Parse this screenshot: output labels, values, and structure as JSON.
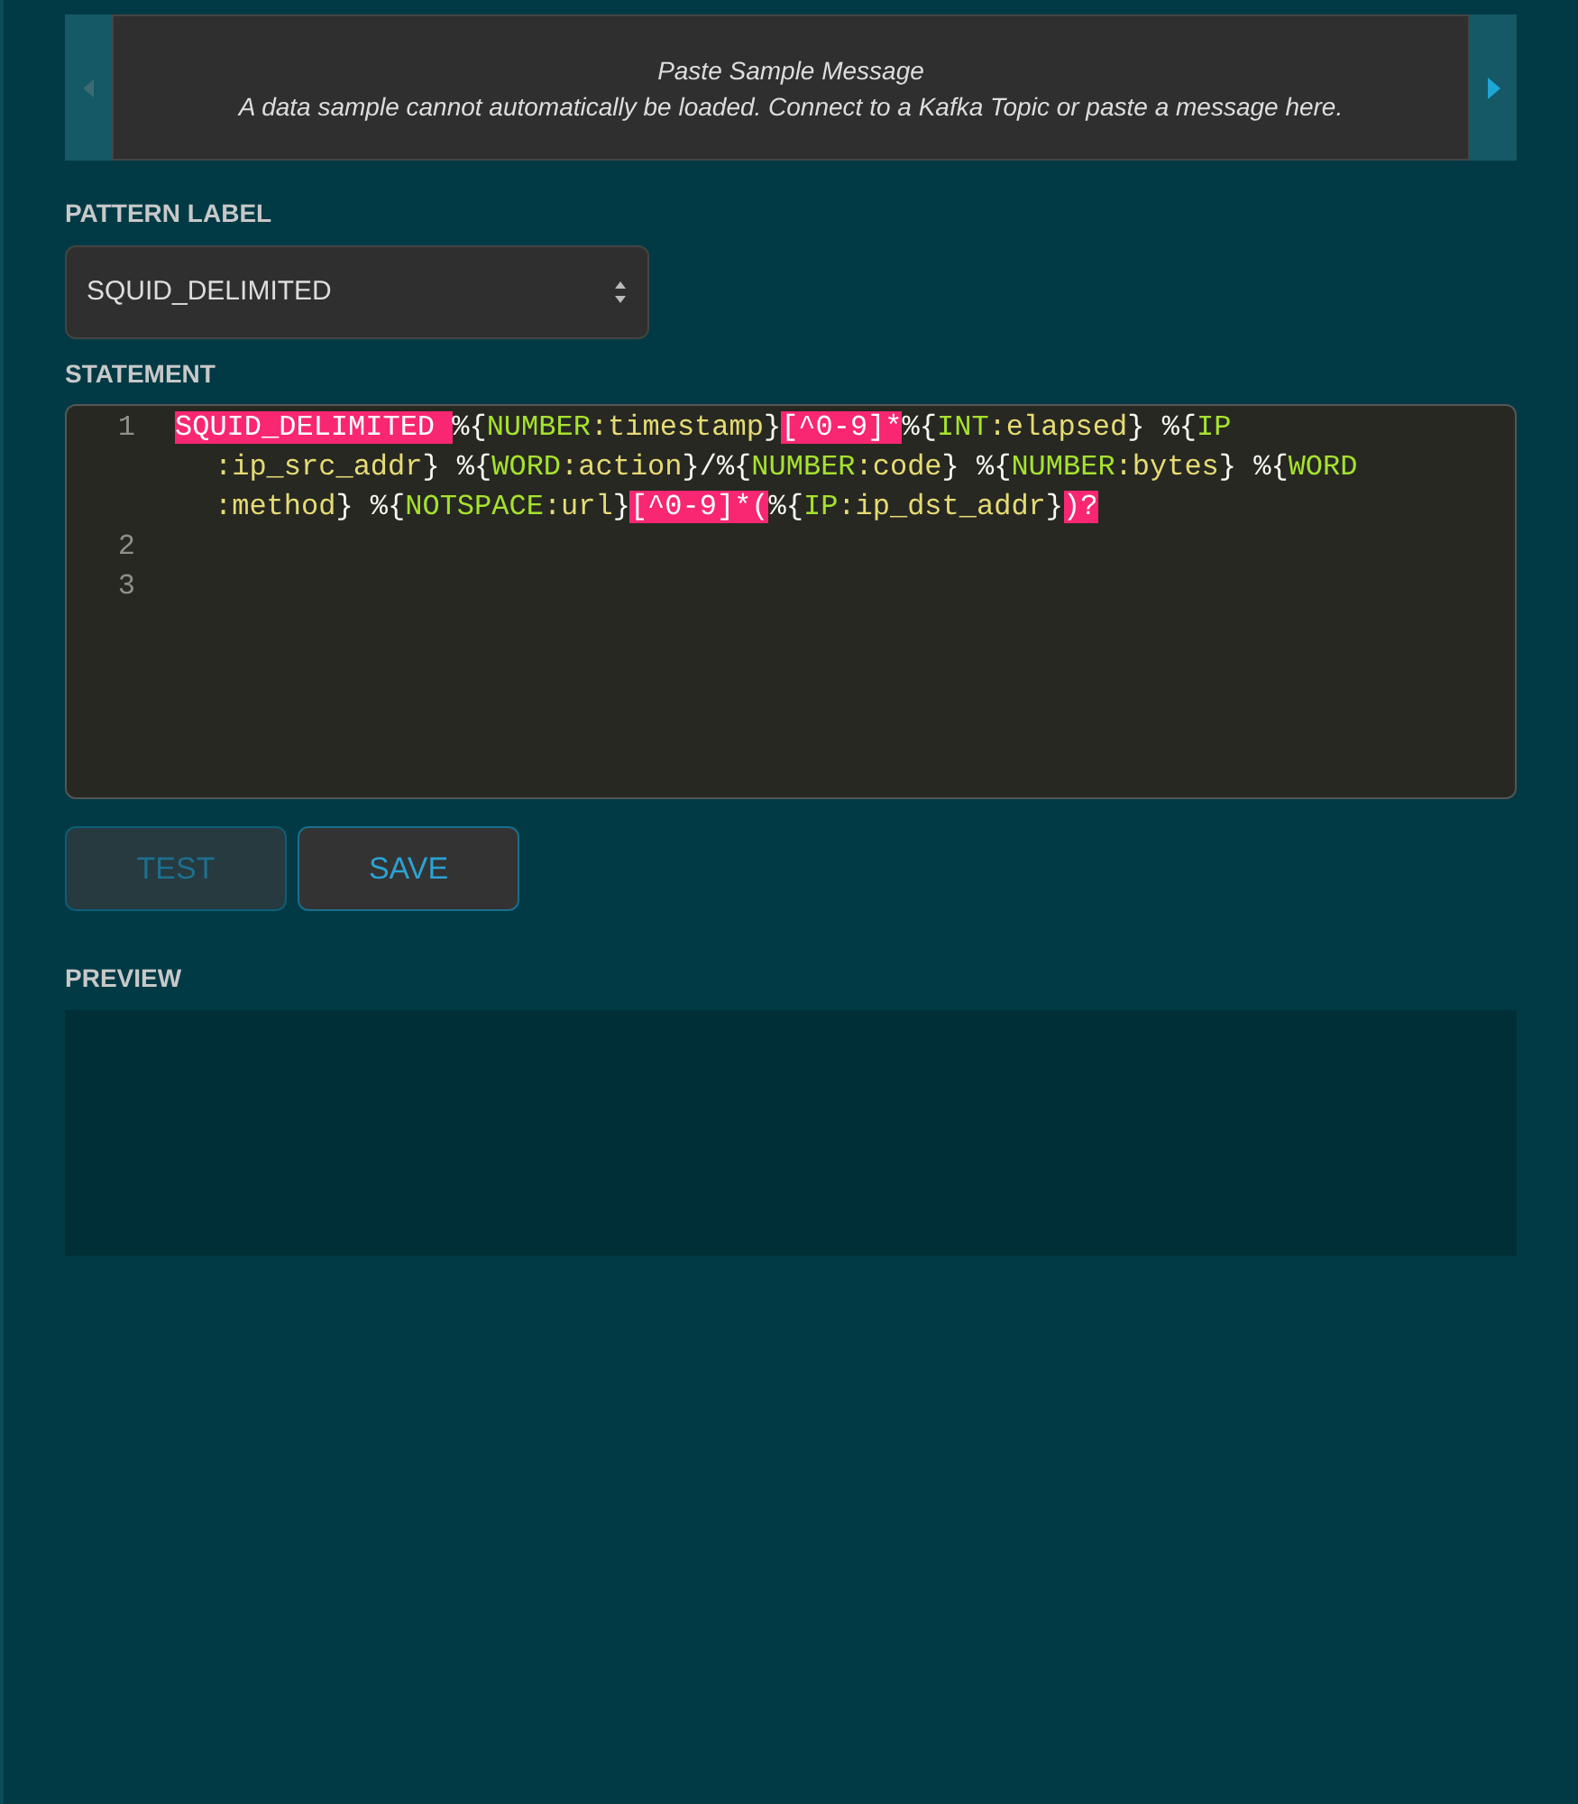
{
  "sample_message": {
    "title": "Paste Sample Message",
    "text": "A data sample cannot automatically be loaded. Connect to a Kafka Topic or paste a message here."
  },
  "pattern_label": {
    "label": "PATTERN LABEL",
    "value": "SQUID_DELIMITED"
  },
  "statement": {
    "label": "STATEMENT",
    "lines": [
      {
        "number": "1",
        "tokens": [
          {
            "kind": "highlight",
            "text": "SQUID_DELIMITED "
          },
          {
            "kind": "punct",
            "text": "%{"
          },
          {
            "kind": "pattern",
            "text": "NUMBER"
          },
          {
            "kind": "field",
            "text": ":timestamp"
          },
          {
            "kind": "punct",
            "text": "}"
          },
          {
            "kind": "highlight",
            "text": "[^0-9]*"
          },
          {
            "kind": "punct",
            "text": "%{"
          },
          {
            "kind": "pattern",
            "text": "INT"
          },
          {
            "kind": "field",
            "text": ":elapsed"
          },
          {
            "kind": "punct",
            "text": "} %{"
          },
          {
            "kind": "pattern",
            "text": "IP"
          },
          {
            "kind": "field",
            "text": ":ip_src_addr"
          },
          {
            "kind": "punct",
            "text": "} %{"
          },
          {
            "kind": "pattern",
            "text": "WORD"
          },
          {
            "kind": "field",
            "text": ":action"
          },
          {
            "kind": "punct",
            "text": "}/%{"
          },
          {
            "kind": "pattern",
            "text": "NUMBER"
          },
          {
            "kind": "field",
            "text": ":code"
          },
          {
            "kind": "punct",
            "text": "} %{"
          },
          {
            "kind": "pattern",
            "text": "NUMBER"
          },
          {
            "kind": "field",
            "text": ":bytes"
          },
          {
            "kind": "punct",
            "text": "} %{"
          },
          {
            "kind": "pattern",
            "text": "WORD"
          },
          {
            "kind": "field",
            "text": ":method"
          },
          {
            "kind": "punct",
            "text": "} %{"
          },
          {
            "kind": "pattern",
            "text": "NOTSPACE"
          },
          {
            "kind": "field",
            "text": ":url"
          },
          {
            "kind": "punct",
            "text": "}"
          },
          {
            "kind": "highlight",
            "text": "[^0-9]*("
          },
          {
            "kind": "punct",
            "text": "%{"
          },
          {
            "kind": "pattern",
            "text": "IP"
          },
          {
            "kind": "field",
            "text": ":ip_dst_addr"
          },
          {
            "kind": "punct",
            "text": "}"
          },
          {
            "kind": "highlight",
            "text": ")?"
          }
        ]
      },
      {
        "number": "2"
      },
      {
        "number": "3"
      }
    ]
  },
  "buttons": [
    {
      "label": "TEST",
      "disabled": true
    },
    {
      "label": "SAVE",
      "disabled": false
    }
  ],
  "preview": {
    "label": "PREVIEW"
  }
}
